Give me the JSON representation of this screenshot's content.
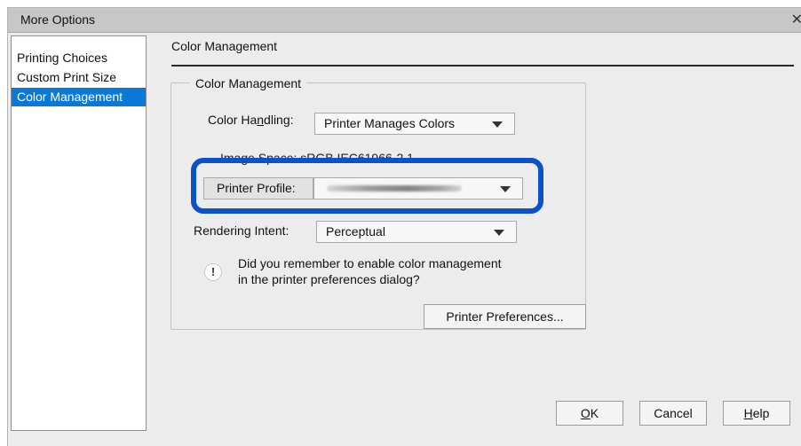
{
  "window": {
    "title": "More Options"
  },
  "nav": {
    "items": [
      {
        "label": "Printing Choices",
        "selected": false
      },
      {
        "label": "Custom Print Size",
        "selected": false
      },
      {
        "label": "Color Management",
        "selected": true
      }
    ]
  },
  "panel": {
    "title": "Color Management",
    "group_title": "Color Management",
    "color_handling": {
      "label_pre": "Color Ha",
      "label_mnemonic": "n",
      "label_post": "dling:",
      "value": "Printer Manages Colors"
    },
    "image_space": {
      "label": "Image Space:",
      "value": "sRGB IEC61966-2.1"
    },
    "printer_profile": {
      "label": "Printer Profile:"
    },
    "rendering_intent": {
      "label": "Rendering Intent:",
      "value": "Perceptual"
    },
    "notice": {
      "line1": "Did you remember to enable color management",
      "line2": "in the printer preferences dialog?"
    },
    "preferences_button": "Printer Preferences..."
  },
  "buttons": {
    "ok": {
      "mnemonic": "O",
      "rest": "K"
    },
    "cancel": "Cancel",
    "help": {
      "mnemonic": "H",
      "rest": "elp"
    }
  },
  "colors": {
    "selection": "#0a78d7",
    "highlight_border": "#0b52c8",
    "dialog_bg": "#ececec",
    "titlebar_bg": "#c7c7c7"
  },
  "icons": {
    "close": "close-icon",
    "info": "info-icon",
    "dropdown": "chevron-down-icon"
  }
}
